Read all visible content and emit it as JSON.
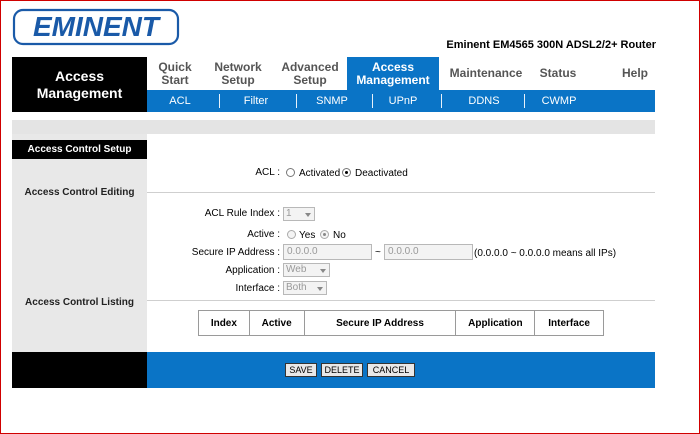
{
  "brand": {
    "logo_text": "EMINENT",
    "model": "Eminent EM4565 300N ADSL2/2+ Router"
  },
  "section_title": "Access Management",
  "nav": [
    {
      "label": "Quick Start"
    },
    {
      "label": "Network Setup"
    },
    {
      "label": "Advanced Setup"
    },
    {
      "label": "Access Management",
      "active": true
    },
    {
      "label": "Maintenance"
    },
    {
      "label": "Status"
    },
    {
      "label": "Help"
    }
  ],
  "subnav": [
    "ACL",
    "Filter",
    "SNMP",
    "UPnP",
    "DDNS",
    "CWMP"
  ],
  "sidebar": {
    "setup_heading": "Access Control Setup",
    "editing_label": "Access Control Editing",
    "listing_label": "Access Control Listing"
  },
  "form": {
    "acl_label": "ACL :",
    "acl_options": [
      "Activated",
      "Deactivated"
    ],
    "acl_selected": "Deactivated",
    "rule_index_label": "ACL Rule Index :",
    "rule_index_value": "1",
    "active_label": "Active :",
    "active_options": [
      "Yes",
      "No"
    ],
    "active_selected": "No",
    "secure_ip_label": "Secure IP Address :",
    "ip_start": "0.0.0.0",
    "ip_separator": "~",
    "ip_end": "0.0.0.0",
    "ip_hint": "(0.0.0.0 ~ 0.0.0.0 means all IPs)",
    "application_label": "Application :",
    "application_value": "Web",
    "interface_label": "Interface :",
    "interface_value": "Both"
  },
  "table": {
    "headers": [
      "Index",
      "Active",
      "Secure IP Address",
      "Application",
      "Interface"
    ]
  },
  "buttons": {
    "save": "SAVE",
    "delete": "DELETE",
    "cancel": "CANCEL"
  },
  "colors": {
    "accent": "#0a74c6",
    "frame": "#d00000"
  }
}
